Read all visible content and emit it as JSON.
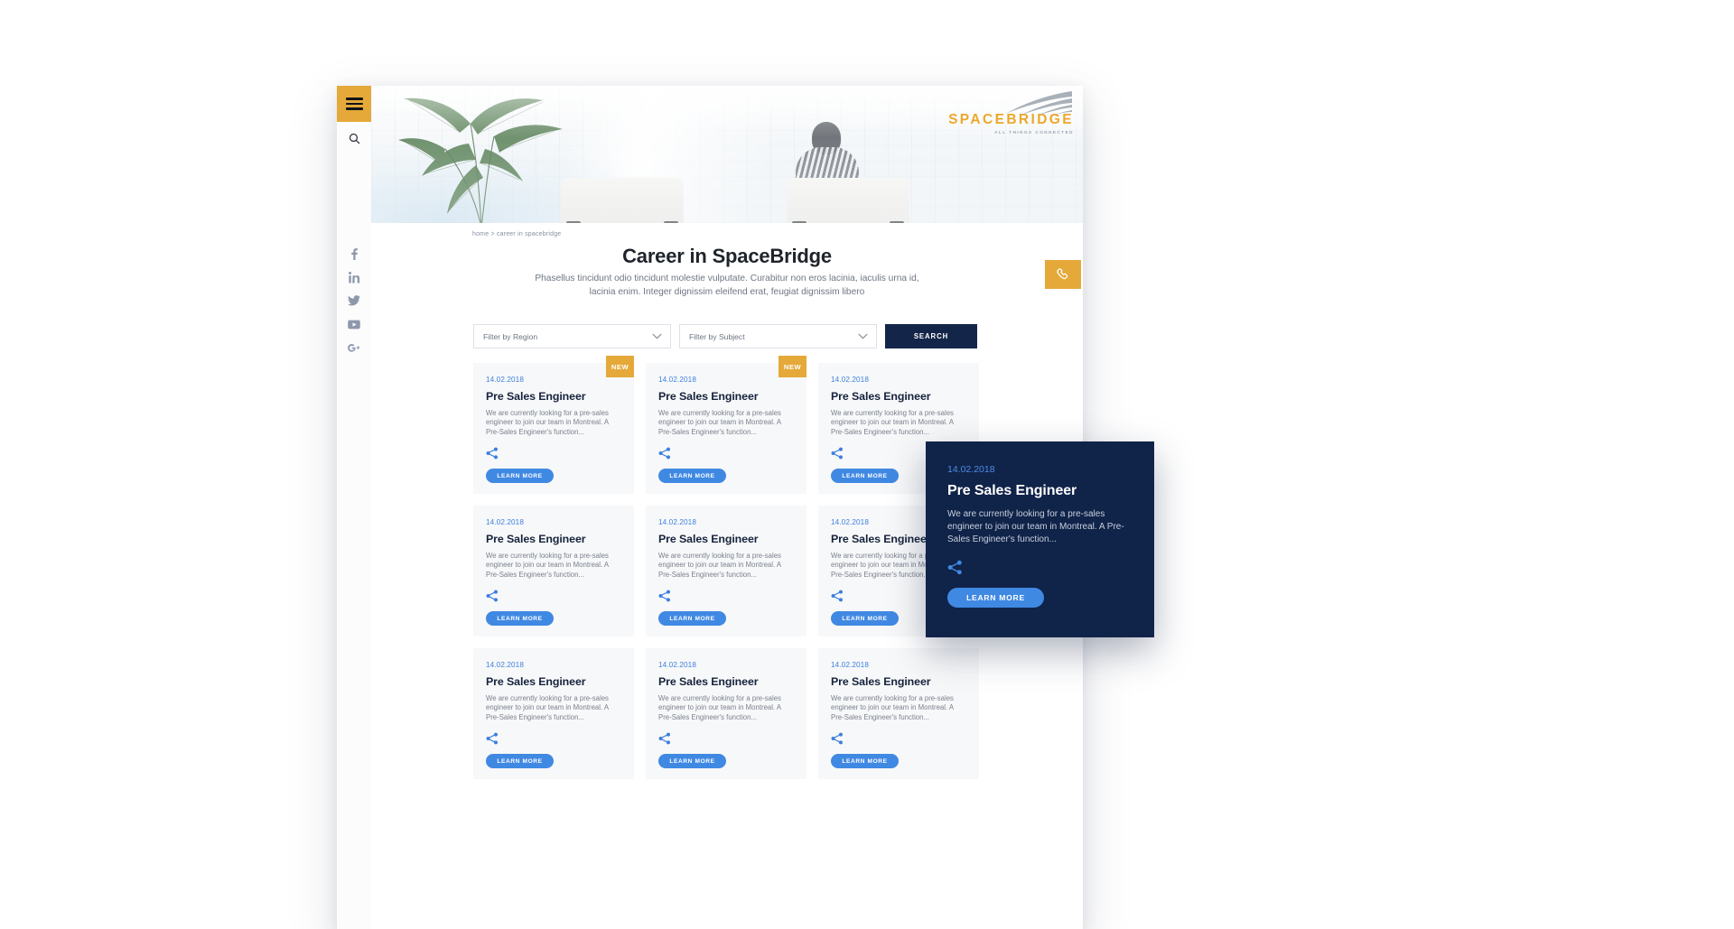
{
  "rail": {
    "menu_icon": "hamburger-menu-icon",
    "search_icon": "search-icon",
    "social": [
      {
        "name": "facebook-icon",
        "glyph": "f"
      },
      {
        "name": "linkedin-icon",
        "glyph": "in"
      },
      {
        "name": "twitter-icon",
        "glyph": "twitter"
      },
      {
        "name": "youtube-icon",
        "glyph": "youtube"
      },
      {
        "name": "googleplus-icon",
        "glyph": "G+"
      }
    ]
  },
  "brand": {
    "name": "SPACEBRIDGE",
    "tagline": "ALL THINGS CONNECTED",
    "color": "#eda829"
  },
  "hero": {
    "alt": "bright office interior with palm plant and seated person"
  },
  "breadcrumb": "home > career in spacebridge",
  "page": {
    "title": "Career in SpaceBridge",
    "subtitle": "Phasellus tincidunt odio tincidunt molestie vulputate. Curabitur non eros lacinia, iaculis urna id, lacinia enim. Integer dignissim eleifend erat, feugiat dignissim libero"
  },
  "filters": {
    "region": {
      "label": "Filter by Region",
      "chevron": "chevron-down-icon"
    },
    "subject": {
      "label": "Filter by Subject",
      "chevron": "chevron-down-icon"
    },
    "search_button": "SEARCH",
    "search_button_color": "#14254a"
  },
  "cards": {
    "new_badge": "NEW",
    "learn_more": "LEARN MORE",
    "share_icon": "share-icon",
    "accent_blue": "#4089e3",
    "badge_color": "#e5a93a",
    "items": [
      {
        "date": "14.02.2018",
        "title": "Pre Sales Engineer",
        "desc": "We are currently looking for a pre-sales engineer to join our team in Montreal. A Pre-Sales Engineer's function...",
        "is_new": true
      },
      {
        "date": "14.02.2018",
        "title": "Pre Sales Engineer",
        "desc": "We are currently looking for a pre-sales engineer to join our team in Montreal. A Pre-Sales Engineer's function...",
        "is_new": true
      },
      {
        "date": "14.02.2018",
        "title": "Pre Sales Engineer",
        "desc": "We are currently looking for a pre-sales engineer to join our team in Montreal. A Pre-Sales Engineer's function...",
        "is_new": false
      },
      {
        "date": "14.02.2018",
        "title": "Pre Sales Engineer",
        "desc": "We are currently looking for a pre-sales engineer to join our team in Montreal. A Pre-Sales Engineer's function...",
        "is_new": false
      },
      {
        "date": "14.02.2018",
        "title": "Pre Sales Engineer",
        "desc": "We are currently looking for a pre-sales engineer to join our team in Montreal. A Pre-Sales Engineer's function...",
        "is_new": false
      },
      {
        "date": "14.02.2018",
        "title": "Pre Sales Engineer",
        "desc": "We are currently looking for a pre-sales engineer to join our team in Montreal. A Pre-Sales Engineer's function...",
        "is_new": false
      },
      {
        "date": "14.02.2018",
        "title": "Pre Sales Engineer",
        "desc": "We are currently looking for a pre-sales engineer to join our team in Montreal. A Pre-Sales Engineer's function...",
        "is_new": false
      },
      {
        "date": "14.02.2018",
        "title": "Pre Sales Engineer",
        "desc": "We are currently looking for a pre-sales engineer to join our team in Montreal. A Pre-Sales Engineer's function...",
        "is_new": false
      },
      {
        "date": "14.02.2018",
        "title": "Pre Sales Engineer",
        "desc": "We are currently looking for a pre-sales engineer to join our team in Montreal. A Pre-Sales Engineer's function...",
        "is_new": false
      }
    ]
  },
  "hover_card": {
    "date": "14.02.2018",
    "title": "Pre Sales Engineer",
    "desc": "We are currently looking for a pre-sales engineer to join our team in Montreal. A Pre-Sales Engineer's function...",
    "learn_more": "LEARN MORE",
    "share_icon": "share-icon",
    "background": "#102349"
  },
  "phone_button": {
    "icon": "phone-icon",
    "color": "#e5a93a"
  }
}
